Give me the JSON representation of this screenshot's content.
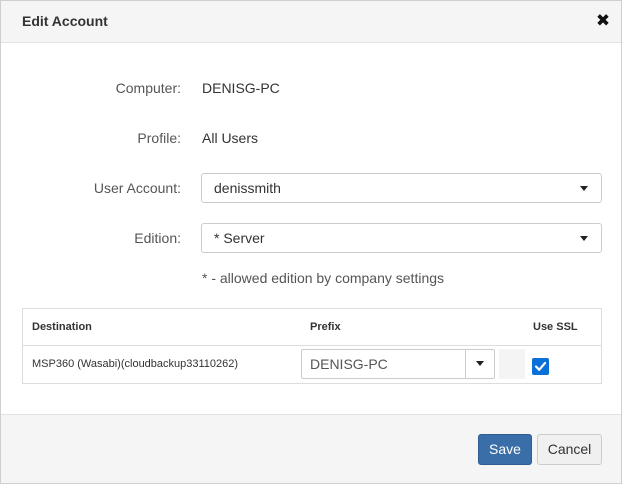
{
  "dialog": {
    "title": "Edit Account",
    "close_symbol": "✖"
  },
  "form": {
    "computer": {
      "label": "Computer:",
      "value": "DENISG-PC"
    },
    "profile": {
      "label": "Profile:",
      "value": "All Users"
    },
    "user_account": {
      "label": "User Account:",
      "selected": "denissmith"
    },
    "edition": {
      "label": "Edition:",
      "selected": "* Server"
    },
    "edition_note": "* - allowed edition by company settings"
  },
  "destinations_table": {
    "headers": {
      "destination": "Destination",
      "prefix": "Prefix",
      "use_ssl": "Use SSL"
    },
    "rows": [
      {
        "destination": "MSP360 (Wasabi)(cloudbackup33110262)",
        "prefix": "DENISG-PC",
        "use_ssl": true
      }
    ]
  },
  "footer": {
    "save_label": "Save",
    "cancel_label": "Cancel"
  },
  "colors": {
    "primary_button": "#3a6ea8",
    "checkbox": "#0a6fd6"
  },
  "icons": {
    "close": "close-icon",
    "dropdown": "chevron-down-icon",
    "checkbox": "checkmark-icon"
  }
}
